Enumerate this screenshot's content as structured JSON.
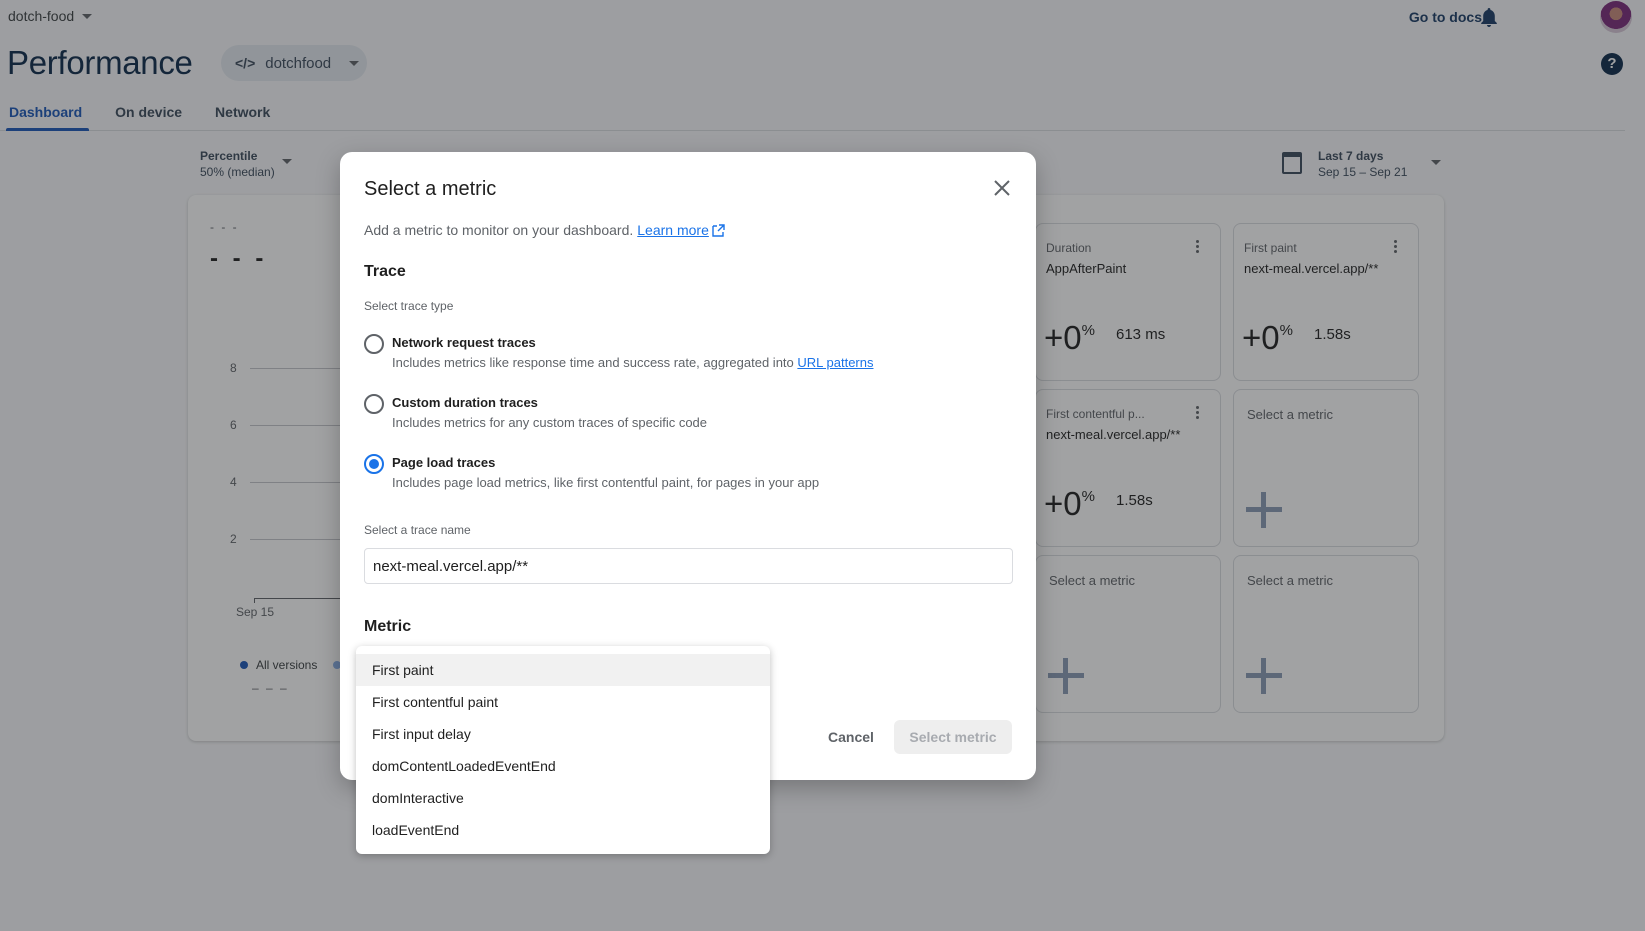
{
  "topbar": {
    "project": "dotch-food",
    "go_to_docs": "Go to docs"
  },
  "header": {
    "title": "Performance",
    "app_selector": "dotchfood",
    "tabs": [
      {
        "label": "Dashboard",
        "active": true
      },
      {
        "label": "On device",
        "active": false
      },
      {
        "label": "Network",
        "active": false
      }
    ]
  },
  "filters": {
    "percentile_label": "Percentile",
    "percentile_value": "50% (median)",
    "date_label": "Last 7 days",
    "date_range": "Sep 15 – Sep 21"
  },
  "main_panel": {
    "small_placeholder": "- - -",
    "big_placeholder": "- - -",
    "y_ticks": [
      "8",
      "6",
      "4",
      "2"
    ],
    "x_tick": "Sep 15",
    "legend_all_versions": "All versions",
    "legend_placeholder": "– – –"
  },
  "cards": [
    {
      "type": "Duration",
      "name": "AppAfterPaint",
      "delta": "+0",
      "delta_unit": "%",
      "value": "613 ms"
    },
    {
      "type": "First paint",
      "name": "next-meal.vercel.app/**",
      "delta": "+0",
      "delta_unit": "%",
      "value": "1.58s"
    },
    {
      "type": "First contentful p...",
      "name": "next-meal.vercel.app/**",
      "delta": "+0",
      "delta_unit": "%",
      "value": "1.58s"
    },
    {
      "placeholder": "Select a metric"
    },
    {
      "placeholder": "Select a metric"
    },
    {
      "placeholder": "Select a metric"
    }
  ],
  "dialog": {
    "title": "Select a metric",
    "subtitle": "Add a metric to monitor on your dashboard.",
    "learn_more": "Learn more",
    "trace_heading": "Trace",
    "trace_type_label": "Select trace type",
    "trace_types": [
      {
        "label": "Network request traces",
        "desc": "Includes metrics like response time and success rate, aggregated into ",
        "link": "URL patterns",
        "selected": false
      },
      {
        "label": "Custom duration traces",
        "desc": "Includes metrics for any custom traces of specific code",
        "selected": false
      },
      {
        "label": "Page load traces",
        "desc": "Includes page load metrics, like first contentful paint, for pages in your app",
        "selected": true
      }
    ],
    "trace_name_label": "Select a trace name",
    "trace_name_value": "next-meal.vercel.app/**",
    "metric_heading": "Metric",
    "cancel": "Cancel",
    "confirm": "Select metric"
  },
  "metric_options": [
    "First paint",
    "First contentful paint",
    "First input delay",
    "domContentLoadedEventEnd",
    "domInteractive",
    "loadEventEnd"
  ],
  "colors": {
    "accent": "#1a73e8",
    "tab_active": "#1a56b8",
    "title": "#0d2a4a"
  }
}
